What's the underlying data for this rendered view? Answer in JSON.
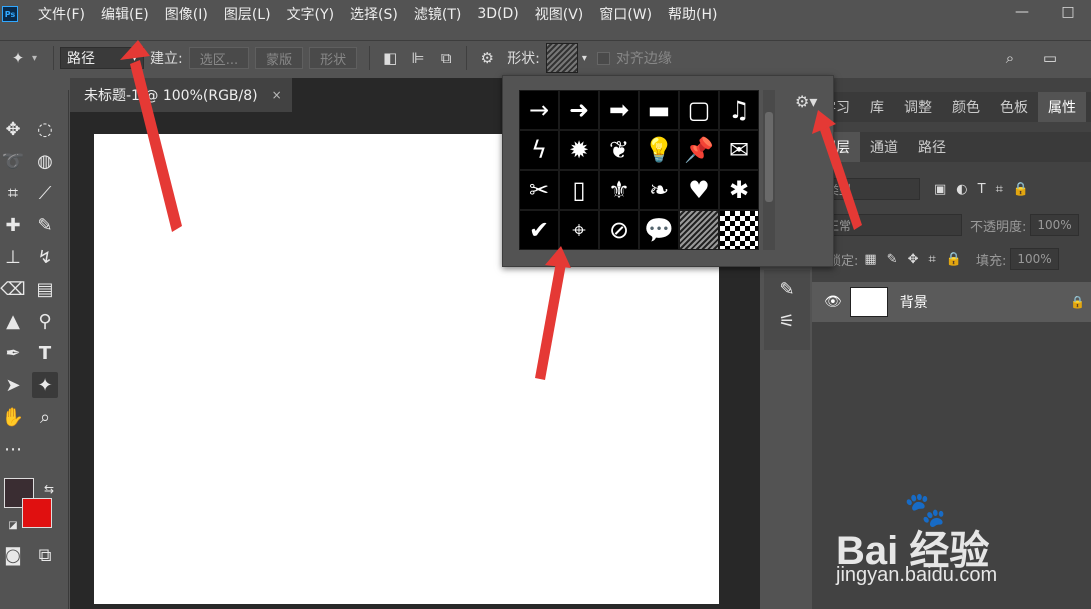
{
  "menu": [
    "文件(F)",
    "编辑(E)",
    "图像(I)",
    "图层(L)",
    "文字(Y)",
    "选择(S)",
    "滤镜(T)",
    "3D(D)",
    "视图(V)",
    "窗口(W)",
    "帮助(H)"
  ],
  "window": {
    "minimize": "—",
    "maximize": "□"
  },
  "options": {
    "mode_value": "路径",
    "build_label": "建立:",
    "selection_btn": "选区...",
    "mask_btn": "蒙版",
    "shape_btn": "形状",
    "shape_label": "形状:",
    "align_edges": "对齐边缘"
  },
  "doc_tab": {
    "title": "未标题-1 @ 100%(RGB/8)",
    "close": "×"
  },
  "shape_picker": {
    "cells": [
      "→",
      "➜",
      "➡",
      "▬",
      "▢",
      "♫",
      "ϟ",
      "✹",
      "❦",
      "💡",
      "📌",
      "✉",
      "✂",
      "▯",
      "⚜",
      "❧",
      "♥",
      "✱",
      "✔",
      "⌖",
      "⊘",
      "💬",
      "",
      ""
    ]
  },
  "right_panel": {
    "tabs_top": [
      "学习",
      "库",
      "调整",
      "颜色",
      "色板",
      "属性"
    ],
    "tabs_layers": [
      "图层",
      "通道",
      "路径"
    ],
    "filter_type": "类型",
    "blend_mode": "正常",
    "opacity_label": "不透明度:",
    "opacity_value": "100%",
    "lock_label": "锁定:",
    "fill_label": "填充:",
    "fill_value": "100%",
    "layer_name": "背景"
  },
  "colors": {
    "foreground": "#3a2d32",
    "background": "#e01010",
    "accent": "#e53935"
  },
  "watermark": {
    "brand": "Bai 经验",
    "url": "jingyan.baidu.com"
  }
}
